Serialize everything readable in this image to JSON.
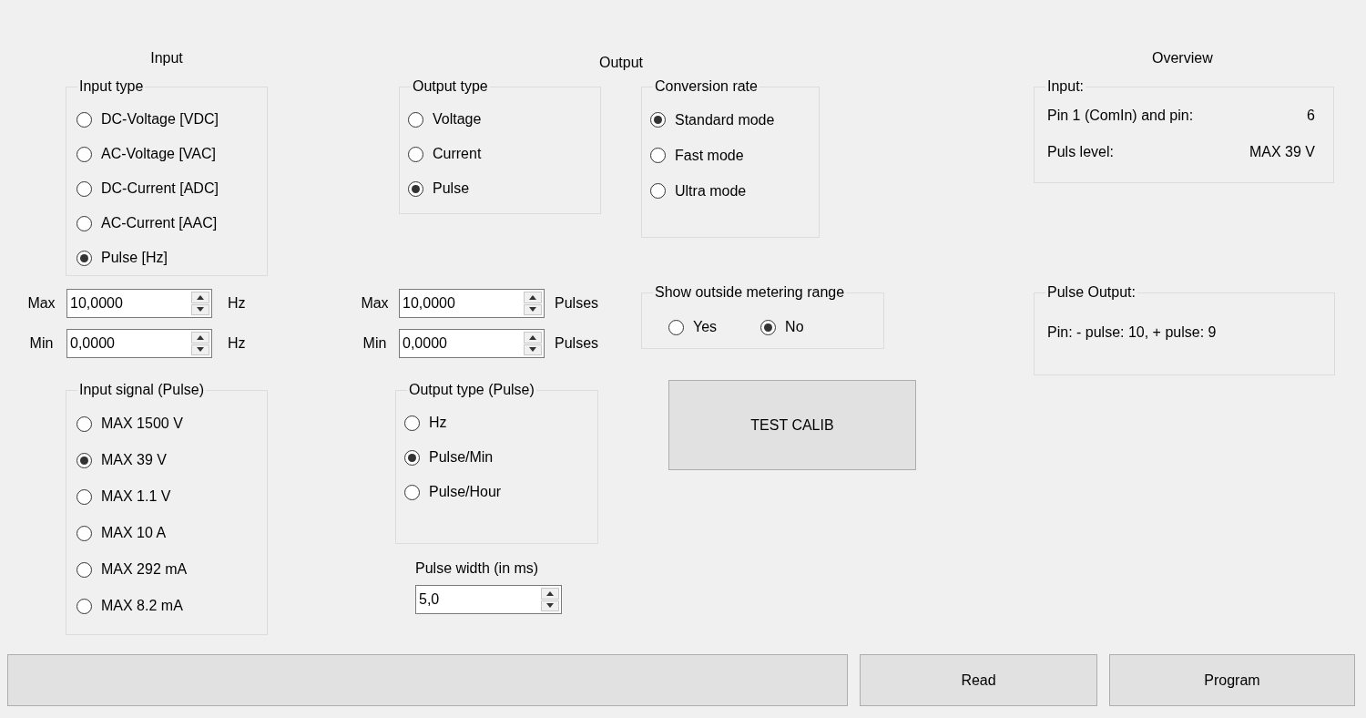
{
  "input": {
    "title": "Input",
    "input_type": {
      "legend": "Input type",
      "options": [
        {
          "label": "DC-Voltage [VDC]",
          "selected": false
        },
        {
          "label": "AC-Voltage [VAC]",
          "selected": false
        },
        {
          "label": "DC-Current [ADC]",
          "selected": false
        },
        {
          "label": "AC-Current [AAC]",
          "selected": false
        },
        {
          "label": "Pulse [Hz]",
          "selected": true
        }
      ]
    },
    "max": {
      "label": "Max",
      "value": "10,0000",
      "unit": "Hz"
    },
    "min": {
      "label": "Min",
      "value": "0,0000",
      "unit": "Hz"
    },
    "input_signal": {
      "legend": "Input signal (Pulse)",
      "options": [
        {
          "label": "MAX 1500 V",
          "selected": false
        },
        {
          "label": "MAX 39 V",
          "selected": true
        },
        {
          "label": "MAX 1.1 V",
          "selected": false
        },
        {
          "label": "MAX 10 A",
          "selected": false
        },
        {
          "label": "MAX 292 mA",
          "selected": false
        },
        {
          "label": "MAX 8.2 mA",
          "selected": false
        }
      ]
    }
  },
  "output": {
    "title": "Output",
    "output_type": {
      "legend": "Output type",
      "options": [
        {
          "label": "Voltage",
          "selected": false
        },
        {
          "label": "Current",
          "selected": false
        },
        {
          "label": "Pulse",
          "selected": true
        }
      ]
    },
    "max": {
      "label": "Max",
      "value": "10,0000",
      "unit": "Pulses"
    },
    "min": {
      "label": "Min",
      "value": "0,0000",
      "unit": "Pulses"
    },
    "output_type_pulse": {
      "legend": "Output type (Pulse)",
      "options": [
        {
          "label": "Hz",
          "selected": false
        },
        {
          "label": "Pulse/Min",
          "selected": true
        },
        {
          "label": "Pulse/Hour",
          "selected": false
        }
      ]
    },
    "pulse_width": {
      "label": "Pulse width (in ms)",
      "value": "5,0"
    },
    "conversion_rate": {
      "legend": "Conversion rate",
      "options": [
        {
          "label": "Standard mode",
          "selected": true
        },
        {
          "label": "Fast mode",
          "selected": false
        },
        {
          "label": "Ultra mode",
          "selected": false
        }
      ]
    },
    "show_outside_metering_range": {
      "legend": "Show outside metering range",
      "options": [
        {
          "label": "Yes",
          "selected": false
        },
        {
          "label": "No",
          "selected": true
        }
      ]
    },
    "test_calib_button": "TEST CALIB"
  },
  "overview": {
    "title": "Overview",
    "input": {
      "legend": "Input:",
      "rows": [
        {
          "label": "Pin 1 (ComIn) and pin:",
          "value": "6"
        },
        {
          "label": "Puls level:",
          "value": "MAX 39 V"
        }
      ]
    },
    "pulse_output": {
      "legend": "Pulse Output:",
      "text": "Pin: - pulse: 10, + pulse: 9"
    }
  },
  "buttons": [
    "Read",
    "Program"
  ]
}
